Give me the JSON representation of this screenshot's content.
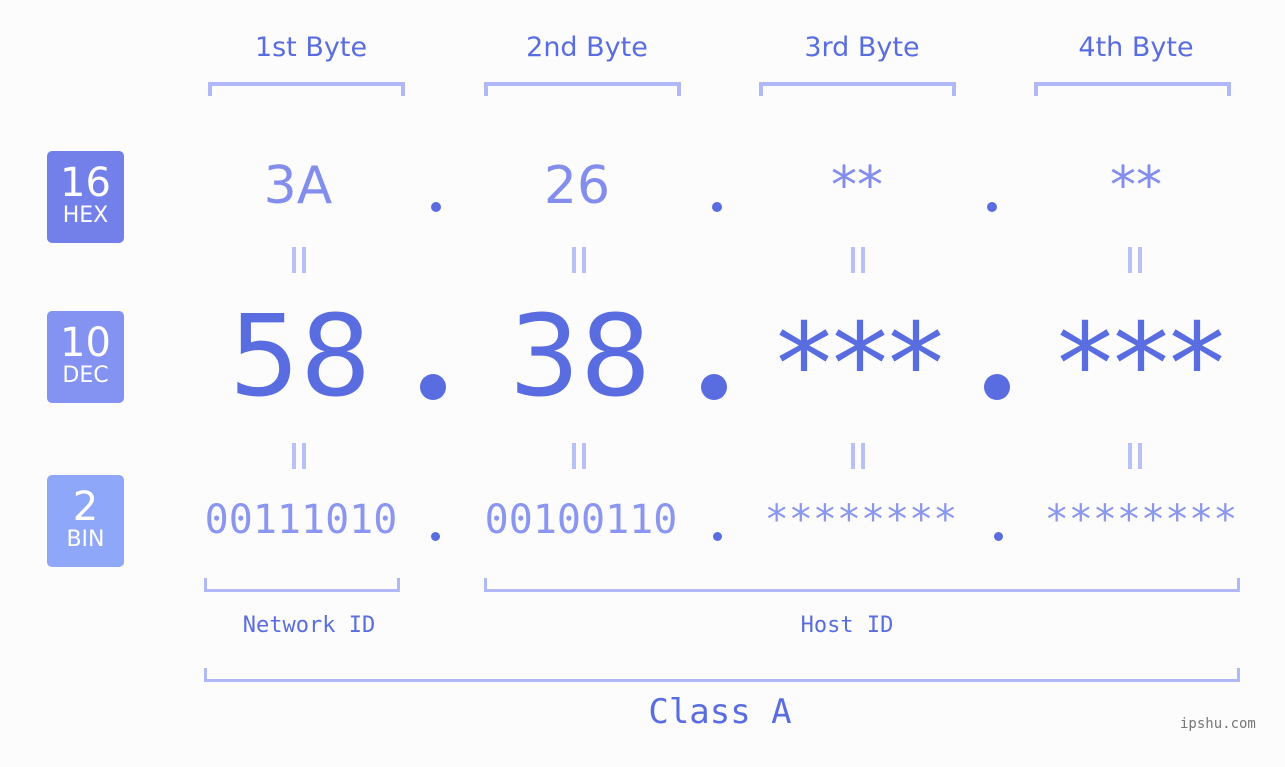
{
  "byte_headers": [
    "1st Byte",
    "2nd Byte",
    "3rd Byte",
    "4th Byte"
  ],
  "bases": [
    {
      "number": "16",
      "label": "HEX",
      "color": "#7380ea"
    },
    {
      "number": "10",
      "label": "DEC",
      "color": "#8492f2"
    },
    {
      "number": "2",
      "label": "BIN",
      "color": "#8fa7f8"
    }
  ],
  "hex_values": [
    "3A",
    "26",
    "**",
    "**"
  ],
  "dec_values": [
    "58",
    "38",
    "***",
    "***"
  ],
  "bin_values": [
    "00111010",
    "00100110",
    "********",
    "********"
  ],
  "separator": ".",
  "network_id_label": "Network ID",
  "host_id_label": "Host ID",
  "class_label": "Class A",
  "watermark": "ipshu.com",
  "colors": {
    "accent": "#5a6de0",
    "bracket": "#b0b8f8",
    "background": "#fbfcfb"
  }
}
